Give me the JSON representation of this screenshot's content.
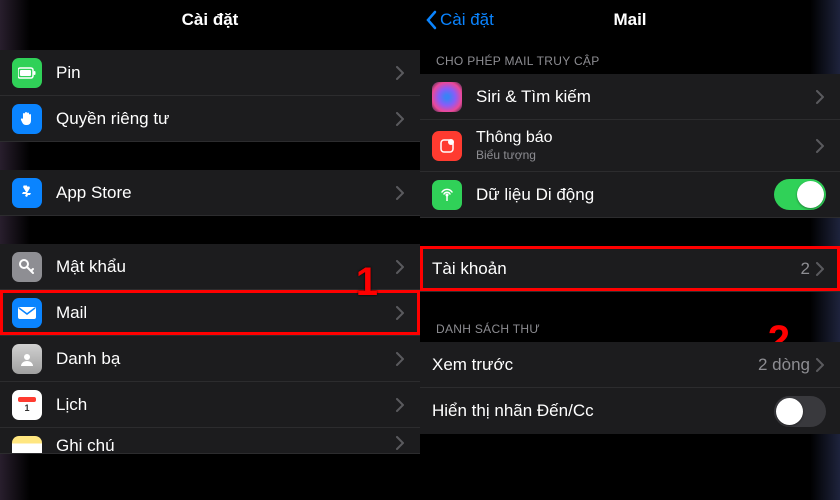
{
  "annotations": {
    "step1": "1",
    "step2": "2"
  },
  "left": {
    "title": "Cài đặt",
    "groups": [
      {
        "items": [
          {
            "id": "battery",
            "label": "Pin",
            "icon": "battery-icon"
          },
          {
            "id": "privacy",
            "label": "Quyền riêng tư",
            "icon": "hand-icon"
          }
        ]
      },
      {
        "items": [
          {
            "id": "appstore",
            "label": "App Store",
            "icon": "appstore-icon"
          }
        ]
      },
      {
        "items": [
          {
            "id": "passwords",
            "label": "Mật khẩu",
            "icon": "key-icon"
          },
          {
            "id": "mail",
            "label": "Mail",
            "icon": "mail-icon",
            "highlight": true
          },
          {
            "id": "contacts",
            "label": "Danh bạ",
            "icon": "contacts-icon"
          },
          {
            "id": "calendar",
            "label": "Lịch",
            "icon": "calendar-icon"
          },
          {
            "id": "notes",
            "label": "Ghi chú",
            "icon": "notes-icon"
          }
        ]
      }
    ]
  },
  "right": {
    "back": "Cài đặt",
    "title": "Mail",
    "section_access": "CHO PHÉP MAIL TRUY CẬP",
    "access_items": [
      {
        "id": "siri",
        "label": "Siri & Tìm kiếm",
        "icon": "siri-icon"
      },
      {
        "id": "notif",
        "label": "Thông báo",
        "sublabel": "Biểu tượng",
        "icon": "notif-icon"
      },
      {
        "id": "cell",
        "label": "Dữ liệu Di động",
        "icon": "antenna-icon",
        "toggle": true
      }
    ],
    "accounts": {
      "label": "Tài khoản",
      "value": "2",
      "highlight": true
    },
    "section_list": "DANH SÁCH THƯ",
    "list_items": [
      {
        "id": "preview",
        "label": "Xem trước",
        "value": "2 dòng"
      },
      {
        "id": "tocc",
        "label": "Hiển thị nhãn Đến/Cc",
        "toggle": false
      }
    ]
  }
}
